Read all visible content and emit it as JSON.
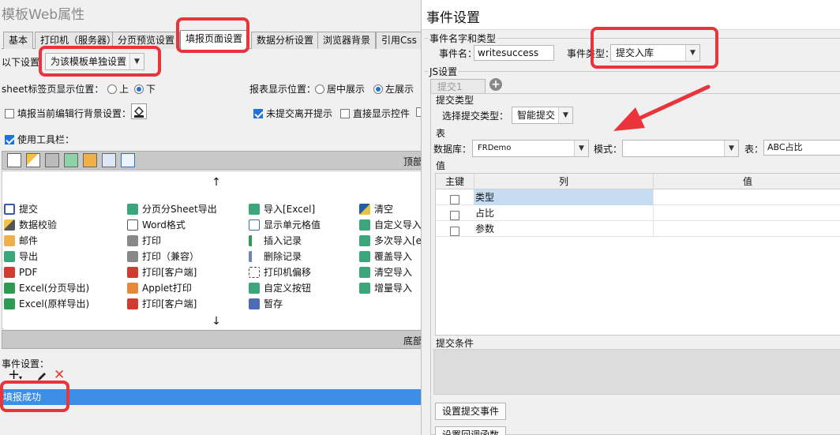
{
  "left": {
    "title": "模板Web属性",
    "tabs": [
      "基本",
      "打印机（服务器）",
      "分页预览设置",
      "填报页面设置",
      "数据分析设置",
      "浏览器背景",
      "引用Css"
    ],
    "active_tab": "填报页面设置",
    "settings_label": "以下设置",
    "settings_value": "为该模板单独设置",
    "sheet_pos_label": "sheet标签页显示位置：",
    "sheet_pos_options": [
      "上",
      "下"
    ],
    "sheet_pos_selected": "下",
    "report_pos_label": "报表显示位置：",
    "report_pos_options": [
      "居中展示",
      "左展示"
    ],
    "report_pos_selected": "左展示",
    "fill_bg_label": "填报当前编辑行背景设置：",
    "unsubmitted_label": "未提交离开提示",
    "direct_show_label": "直接显示控件",
    "use_toolbar_label": "使用工具栏：",
    "top_label": "顶部",
    "bottom_label": "底部",
    "up_arrow": "↑",
    "down_arrow": "↓",
    "items": [
      [
        "提交",
        "分页分Sheet导出",
        "导入[Excel]",
        "清空"
      ],
      [
        "数据校验",
        "Word格式",
        "显示单元格值",
        "自定义导入["
      ],
      [
        "邮件",
        "打印",
        "插入记录",
        "多次导入[ex"
      ],
      [
        "导出",
        "打印（兼容）",
        "删除记录",
        "覆盖导入"
      ],
      [
        "PDF",
        "打印[客户端]",
        "打印机偏移",
        "清空导入"
      ],
      [
        "Excel(分页导出)",
        "Applet打印",
        "自定义按钮",
        "增量导入"
      ],
      [
        "Excel(原样导出)",
        "打印[客户端]",
        "暂存",
        ""
      ]
    ],
    "events_label": "事件设置：",
    "event_item": "填报成功"
  },
  "dialog": {
    "title": "事件设置",
    "group_name_type": "事件名字和类型",
    "event_name_label": "事件名：",
    "event_name_value": "writesuccess",
    "event_type_label": "事件类型：",
    "event_type_value": "提交入库",
    "js_group": "JS设置",
    "submit_tab": "提交1",
    "add_icon": "+",
    "submit_type_group": "提交类型",
    "choose_type_label": "选择提交类型：",
    "choose_type_value": "智能提交",
    "table_group": "表",
    "db_label": "数据库：",
    "db_value": "FRDemo",
    "schema_label": "模式：",
    "schema_value": "",
    "table_label": "表：",
    "table_value": "ABC占比",
    "value_group": "值",
    "columns": [
      "主键",
      "列",
      "值"
    ],
    "rows": [
      {
        "col": "类型",
        "val": ""
      },
      {
        "col": "占比",
        "val": ""
      },
      {
        "col": "参数",
        "val": ""
      }
    ],
    "condition_group": "提交条件",
    "set_submit_event": "设置提交事件",
    "set_callback": "设置回调函数"
  },
  "colors": {
    "highlight": "#e8343a",
    "selection": "#3d8fe6",
    "accent": "#1e73d8"
  }
}
